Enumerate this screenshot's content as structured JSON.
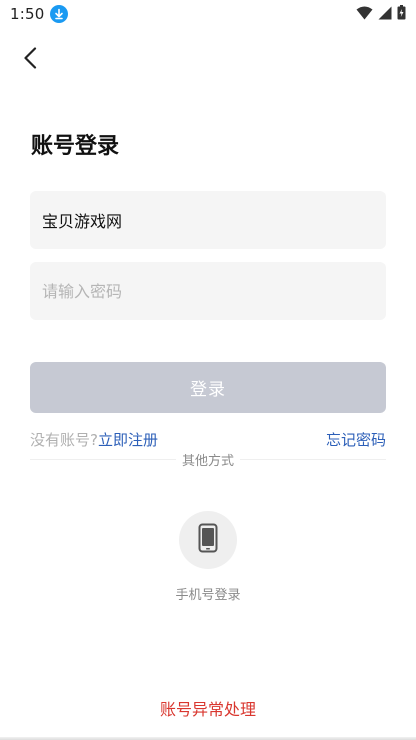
{
  "status_bar": {
    "time": "1:50",
    "icons": [
      "download-icon",
      "wifi-icon",
      "signal-icon",
      "battery-icon"
    ]
  },
  "header": {
    "back_icon": "chevron-left-icon"
  },
  "login": {
    "title": "账号登录",
    "account_value": "宝贝游戏网",
    "password_placeholder": "请输入密码",
    "login_label": "登录",
    "no_account_text": "没有账号?",
    "register_link": "立即注册",
    "forgot_link": "忘记密码"
  },
  "other_methods": {
    "title": "其他方式",
    "phone_label": "手机号登录",
    "phone_icon": "phone-icon"
  },
  "footer": {
    "issue_link": "账号异常处理"
  },
  "colors": {
    "link_blue": "#2c5fb8",
    "danger_red": "#d9372f",
    "disabled_button": "#c6c9d3",
    "input_bg": "#f5f5f5",
    "download_badge": "#1a9af2"
  }
}
